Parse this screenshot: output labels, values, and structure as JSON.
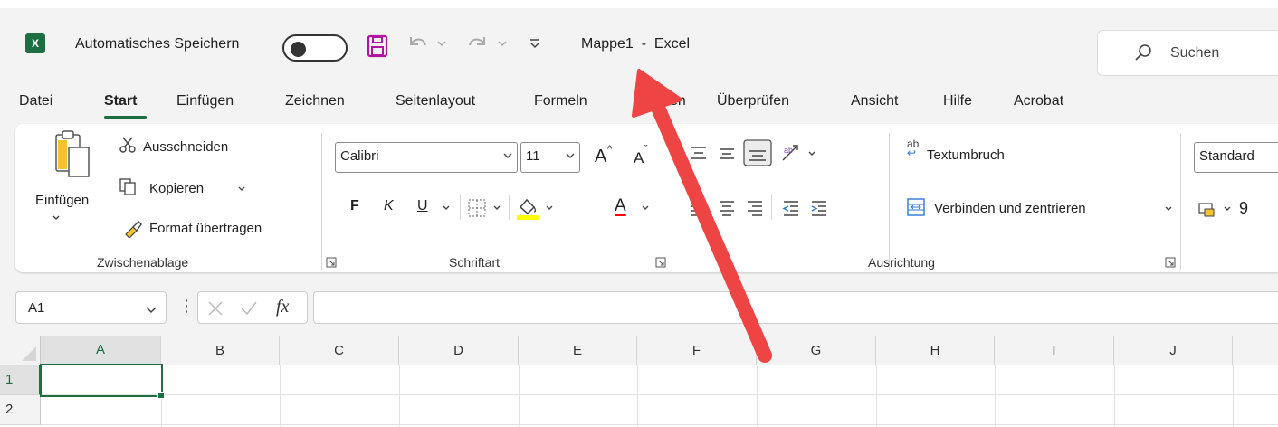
{
  "app": {
    "logo_text": "X",
    "autosave_label": "Automatisches Speichern",
    "doc_title": "Mappe1  -  Excel",
    "search_placeholder": "Suchen"
  },
  "menu": [
    {
      "label": "Datei"
    },
    {
      "label": "Start"
    },
    {
      "label": "Einfügen"
    },
    {
      "label": "Zeichnen"
    },
    {
      "label": "Seitenlayout"
    },
    {
      "label": "Formeln"
    },
    {
      "label": "en"
    },
    {
      "label": "Überprüfen"
    },
    {
      "label": "Ansicht"
    },
    {
      "label": "Hilfe"
    },
    {
      "label": "Acrobat"
    }
  ],
  "ribbon": {
    "clipboard": {
      "paste_label": "Einfügen",
      "cut_label": "Ausschneiden",
      "copy_label": "Kopieren",
      "format_painter_label": "Format übertragen",
      "group_label": "Zwischenablage"
    },
    "font": {
      "font_name": "Calibri",
      "font_size": "11",
      "bold": "F",
      "italic": "K",
      "underline": "U",
      "grow": "A",
      "shrink": "A",
      "color_letter": "A",
      "group_label": "Schriftart"
    },
    "alignment": {
      "wrap_label": "Textumbruch",
      "wrap_icon_text": "ab",
      "merge_label": "Verbinden und zentrieren",
      "group_label": "Ausrichtung"
    },
    "number": {
      "format_value": "Standard",
      "currency_partial": "9"
    }
  },
  "formula_bar": {
    "cell_ref": "A1",
    "dots": "⋮",
    "fx": "fx",
    "formula": ""
  },
  "grid": {
    "columns": [
      "A",
      "B",
      "C",
      "D",
      "E",
      "F",
      "G",
      "H",
      "I",
      "J"
    ],
    "rows": [
      "1",
      "2"
    ],
    "selected_cell": "A1"
  },
  "colors": {
    "excel_green": "#1d6f42",
    "arrow_red": "#ee4444",
    "highlight_yellow": "#ffff00",
    "font_red": "#ff0000"
  }
}
